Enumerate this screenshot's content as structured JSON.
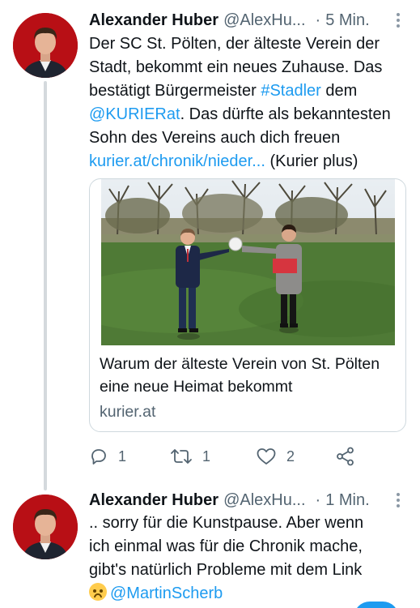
{
  "tweets": [
    {
      "author_name": "Alexander Huber",
      "handle": "@AlexHu...",
      "separator": "·",
      "time": "5 Min.",
      "text_lines": [
        [
          "Der SC St. Pölten, der älteste Verein der"
        ],
        [
          "Stadt, bekommt ein neues Zuhause. Das"
        ],
        [
          "bestätigt Bürgermeister ",
          "#Stadler",
          " dem"
        ],
        [
          "@KURIERat",
          ". Das dürfte als bekanntesten"
        ],
        [
          "Sohn des Vereins auch dich freuen"
        ],
        [
          "kurier.at/chronik/nieder...",
          " (Kurier plus)"
        ]
      ],
      "card": {
        "title": "Warum der älteste Verein von St. Pölten eine neue Heimat bekommt",
        "domain": "kurier.at"
      },
      "actions": {
        "reply_count": "1",
        "retweet_count": "1",
        "like_count": "2"
      }
    },
    {
      "author_name": "Alexander Huber",
      "handle": "@AlexHu...",
      "separator": "·",
      "time": "1 Min.",
      "text_lines": [
        [
          ".. sorry für die Kunstpause. Aber wenn"
        ],
        [
          "ich einmal was für die Chronik mache,"
        ],
        [
          "gibt's natürlich Probleme mit dem Link"
        ]
      ],
      "last_line_mention": "@MartinScherb",
      "emoji_icon": "upside-down-face-emoji"
    }
  ],
  "colors": {
    "link": "#1d9bf0",
    "text": "#0f1419",
    "secondary": "#536471",
    "avatar_bg": "#b80f15"
  }
}
